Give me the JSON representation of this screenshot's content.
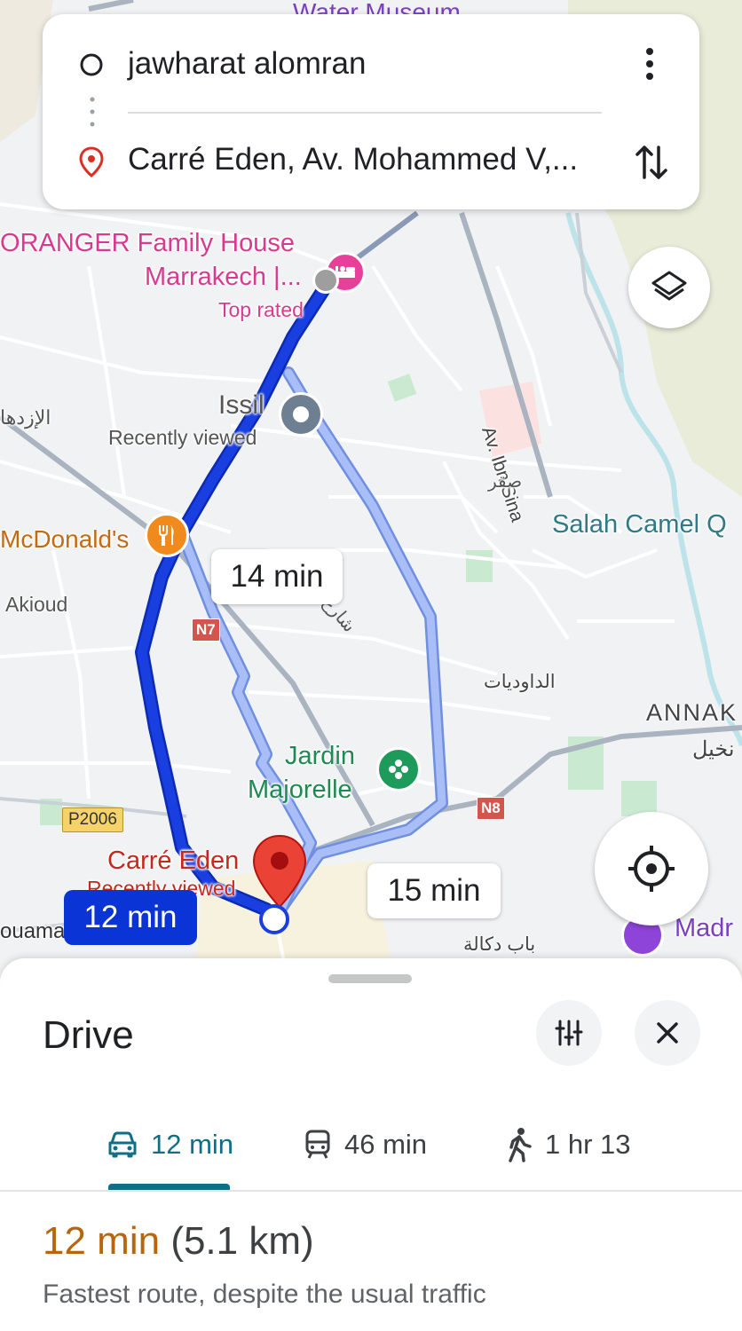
{
  "search": {
    "origin": "jawharat alomran",
    "destination": "Carré Eden, Av. Mohammed V,..."
  },
  "map": {
    "labels": {
      "water_museum": "Water Museum",
      "oranger_line1": "ORANGER Family House",
      "oranger_line2": "Marrakech |...",
      "oranger_sub": "Top rated",
      "issil": "Issil",
      "issil_sub": "Recently viewed",
      "aldaha": "الإزدها",
      "mcdonalds": "McDonald's",
      "akioud": "Akioud",
      "n7": "N7",
      "street_ar": "شارع",
      "av_ibn_sina": "Av. Ibn Sina",
      "saqr": "صقر",
      "salah_camel": "Salah Camel Q",
      "dawadiyat": "الداوديات",
      "annak": "ANNAK",
      "nakhil": "نخيل",
      "jardin_line1": "Jardin",
      "jardin_line2": "Majorelle",
      "n8": "N8",
      "p2006": "P2006",
      "carre_eden": "Carré Eden",
      "carre_eden_sub": "Recently viewed",
      "douama": "ouama",
      "bab_doukkala": "باب دكالة",
      "madr": "Madr"
    },
    "route_badges": {
      "selected": "12 min",
      "alt1": "14 min",
      "alt2": "15 min"
    },
    "colors": {
      "selected_route": "#1a3fe0",
      "alt_route": "#a9bdf7",
      "poi_pink": "#e8409a",
      "poi_orange": "#f08a1c",
      "park_green": "#1e9a5a",
      "destination_red": "#d93025"
    }
  },
  "sheet": {
    "title": "Drive",
    "modes": [
      {
        "icon": "car-icon",
        "label": "12 min",
        "selected": true
      },
      {
        "icon": "transit-icon",
        "label": "46 min",
        "selected": false
      },
      {
        "icon": "walk-icon",
        "label": "1 hr 13",
        "selected": false
      }
    ],
    "summary_time": "12 min",
    "summary_distance": "(5.1 km)",
    "summary_desc": "Fastest route, despite the usual traffic",
    "colors": {
      "accent": "#0f6f86",
      "time_orange": "#b8660c"
    }
  }
}
